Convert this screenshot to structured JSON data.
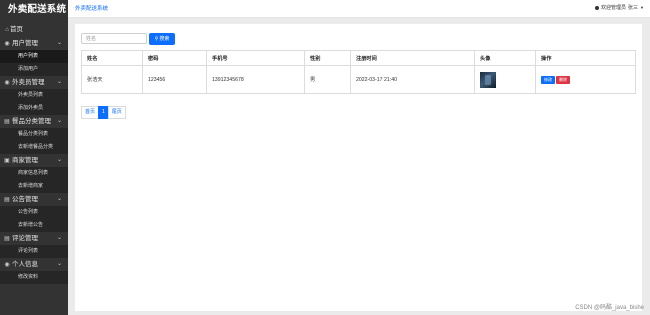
{
  "app": {
    "title": "外卖配送系统"
  },
  "topbar": {
    "breadcrumb": "外卖配送系统",
    "welcome": "欢迎管理员",
    "user_name": "张三",
    "dropdown_icon": "caret-down-icon"
  },
  "sidebar": {
    "home": {
      "label": "首页",
      "icon": "home-icon"
    },
    "groups": [
      {
        "label": "用户管理",
        "icon": "users-icon",
        "items": [
          {
            "label": "用户列表",
            "active": true
          },
          {
            "label": "添加用户",
            "active": false
          }
        ]
      },
      {
        "label": "外卖员管理",
        "icon": "rider-icon",
        "items": [
          {
            "label": "外卖员列表",
            "active": false
          },
          {
            "label": "添加外卖员",
            "active": false
          }
        ]
      },
      {
        "label": "餐品分类管理",
        "icon": "category-icon",
        "items": [
          {
            "label": "餐品分类列表",
            "active": false
          },
          {
            "label": "去新增餐品分类",
            "active": false
          }
        ]
      },
      {
        "label": "商家管理",
        "icon": "store-icon",
        "items": [
          {
            "label": "商家信息列表",
            "active": false
          },
          {
            "label": "去新增商家",
            "active": false
          }
        ]
      },
      {
        "label": "公告管理",
        "icon": "notice-icon",
        "items": [
          {
            "label": "公告列表",
            "active": false
          },
          {
            "label": "去新增公告",
            "active": false
          }
        ]
      },
      {
        "label": "评论管理",
        "icon": "comment-icon",
        "items": [
          {
            "label": "评论列表",
            "active": false
          }
        ]
      },
      {
        "label": "个人信息",
        "icon": "profile-icon",
        "items": [
          {
            "label": "修改资料",
            "active": false
          }
        ]
      }
    ]
  },
  "search": {
    "placeholder": "姓名",
    "button_label": "搜索",
    "button_icon": "search-icon"
  },
  "table": {
    "headers": [
      "姓名",
      "密码",
      "手机号",
      "性别",
      "注册时间",
      "头像",
      "操作"
    ],
    "rows": [
      {
        "name": "张浩天",
        "password": "123456",
        "phone": "13912345678",
        "gender": "男",
        "registered": "2022-03-17 21:40",
        "edit_label": "修改",
        "delete_label": "删除"
      }
    ]
  },
  "pagination": {
    "first": "首页",
    "current": "1",
    "last": "尾页"
  },
  "watermark": "CSDN @码酷_java_bishe",
  "colors": {
    "primary": "#0d6efd",
    "danger": "#dc3545",
    "sidebar_bg": "#333333",
    "page_bg": "#ebebeb"
  }
}
